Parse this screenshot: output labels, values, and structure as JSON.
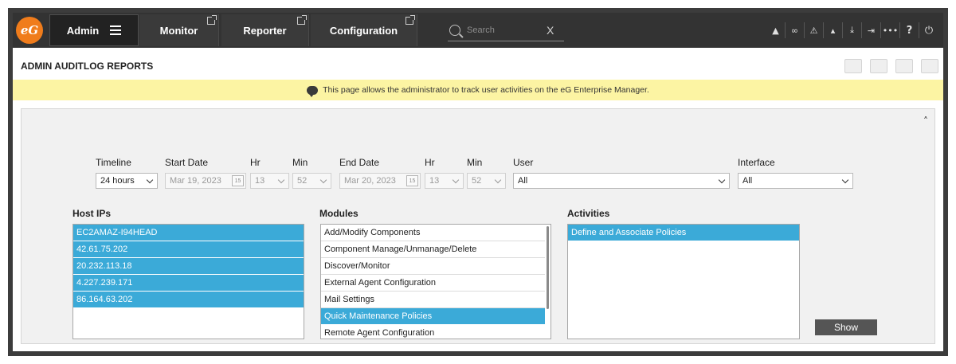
{
  "nav": {
    "logo_text": "eG",
    "tabs": [
      {
        "label": "Admin"
      },
      {
        "label": "Monitor"
      },
      {
        "label": "Reporter"
      },
      {
        "label": "Configuration"
      }
    ],
    "search": {
      "placeholder": "Search",
      "clear": "X"
    },
    "icons": [
      {
        "name": "user-icon",
        "glyph": "▲"
      },
      {
        "name": "link-icon",
        "glyph": "∞"
      },
      {
        "name": "alert-icon",
        "glyph": "⚠"
      },
      {
        "name": "bell-icon",
        "glyph": "▴"
      },
      {
        "name": "download-icon",
        "glyph": "⤓"
      },
      {
        "name": "signout-icon",
        "glyph": "⇥"
      },
      {
        "name": "more-icon",
        "glyph": "•••"
      },
      {
        "name": "help-icon",
        "glyph": "?"
      },
      {
        "name": "power-icon",
        "glyph": "⏻"
      }
    ]
  },
  "page": {
    "title": "ADMIN AUDITLOG REPORTS",
    "info": "This page allows the administrator to track user activities on the eG Enterprise Manager.",
    "collapse": "˄"
  },
  "filters": {
    "timeline": {
      "label": "Timeline",
      "value": "24 hours"
    },
    "start_date": {
      "label": "Start Date",
      "value": "Mar 19, 2023"
    },
    "start_hr": {
      "label": "Hr",
      "value": "13"
    },
    "start_min": {
      "label": "Min",
      "value": "52"
    },
    "end_date": {
      "label": "End Date",
      "value": "Mar 20, 2023"
    },
    "end_hr": {
      "label": "Hr",
      "value": "13"
    },
    "end_min": {
      "label": "Min",
      "value": "52"
    },
    "user": {
      "label": "User",
      "value": "All"
    },
    "interface": {
      "label": "Interface",
      "value": "All"
    },
    "calendar_day": "15"
  },
  "host_ips": {
    "label": "Host IPs",
    "items": [
      "EC2AMAZ-I94HEAD",
      "42.61.75.202",
      "20.232.113.18",
      "4.227.239.171",
      "86.164.63.202"
    ]
  },
  "modules": {
    "label": "Modules",
    "items": [
      "Add/Modify Components",
      "Component Manage/Unmanage/Delete",
      "Discover/Monitor",
      "External Agent Configuration",
      "Mail Settings",
      "Quick Maintenance Policies",
      "Remote Agent Configuration"
    ],
    "selected": "Quick Maintenance Policies"
  },
  "activities": {
    "label": "Activities",
    "items": [
      "Define and Associate Policies"
    ]
  },
  "show_label": "Show",
  "colors": {
    "accent": "#3baad8",
    "nav_bg": "#333333",
    "info_bg": "#fcf4a3",
    "logo": "#f07c1b"
  }
}
